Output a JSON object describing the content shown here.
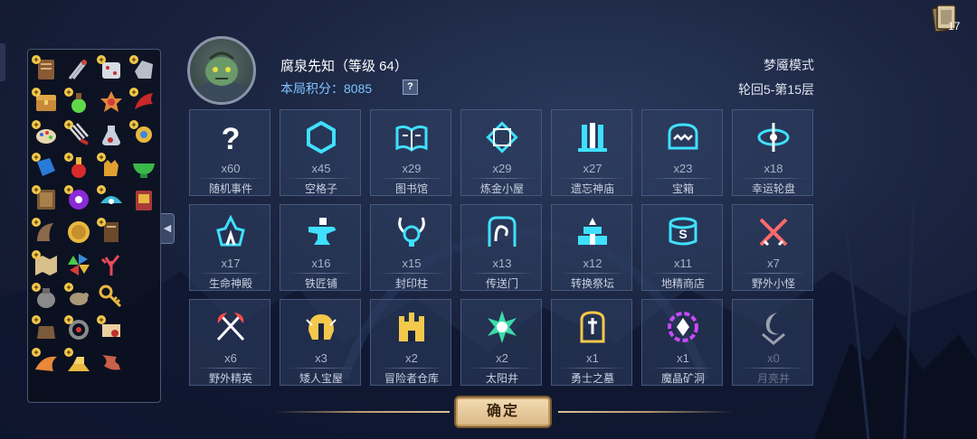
{
  "player": {
    "name_line": "腐泉先知（等级 64）",
    "score_line": "本局积分：8085",
    "help_glyph": "?"
  },
  "run": {
    "mode": "梦魇模式",
    "cycle": "轮回5-第15层"
  },
  "deck_count": "17",
  "collapse_glyph": "◀",
  "inventory_plus": "+",
  "tiles": [
    {
      "icon": "question-icon",
      "count": "x60",
      "name": "随机事件"
    },
    {
      "icon": "hexagon-icon",
      "count": "x45",
      "name": "空格子"
    },
    {
      "icon": "book-icon",
      "count": "x29",
      "name": "图书馆"
    },
    {
      "icon": "alchemy-icon",
      "count": "x29",
      "name": "炼金小屋"
    },
    {
      "icon": "temple-icon",
      "count": "x27",
      "name": "遗忘神庙"
    },
    {
      "icon": "chest-icon",
      "count": "x23",
      "name": "宝箱"
    },
    {
      "icon": "wheel-icon",
      "count": "x18",
      "name": "幸运轮盘"
    },
    {
      "icon": "shrine-icon",
      "count": "x17",
      "name": "生命神殿"
    },
    {
      "icon": "anvil-icon",
      "count": "x16",
      "name": "铁匠铺"
    },
    {
      "icon": "seal-icon",
      "count": "x15",
      "name": "封印柱"
    },
    {
      "icon": "portal-icon",
      "count": "x13",
      "name": "传送门"
    },
    {
      "icon": "altar-icon",
      "count": "x12",
      "name": "转换祭坛"
    },
    {
      "icon": "goblin-shop-icon",
      "count": "x11",
      "name": "地精商店"
    },
    {
      "icon": "crossed-swords-icon",
      "count": "x7",
      "name": "野外小怪"
    },
    {
      "icon": "crossed-axes-icon",
      "count": "x6",
      "name": "野外精英"
    },
    {
      "icon": "helmet-icon",
      "count": "x3",
      "name": "矮人宝屋"
    },
    {
      "icon": "castle-icon",
      "count": "x2",
      "name": "冒险者仓库"
    },
    {
      "icon": "sun-icon",
      "count": "x2",
      "name": "太阳井"
    },
    {
      "icon": "tomb-icon",
      "count": "x1",
      "name": "勇士之墓"
    },
    {
      "icon": "crystal-icon",
      "count": "x1",
      "name": "魔晶矿洞"
    },
    {
      "icon": "moon-icon",
      "count": "x0",
      "name": "月亮井"
    }
  ],
  "confirm_label": "确定",
  "colors": {
    "accent_cyan": "#3fe0ff",
    "gold": "#f3c84b",
    "score_blue": "#7ec6ff"
  }
}
